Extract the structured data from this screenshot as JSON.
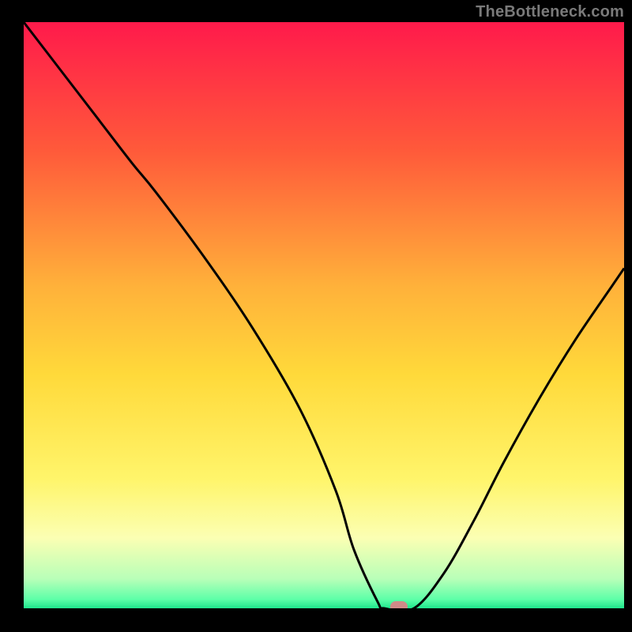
{
  "watermark": "TheBottleneck.com",
  "chart_data": {
    "type": "line",
    "title": "",
    "xlabel": "",
    "ylabel": "",
    "xlim": [
      0,
      100
    ],
    "ylim": [
      0,
      100
    ],
    "grid": false,
    "legend": "none",
    "background_gradient": [
      {
        "stop": 0.0,
        "color": "#ff1a4b"
      },
      {
        "stop": 0.22,
        "color": "#ff5a3a"
      },
      {
        "stop": 0.45,
        "color": "#ffb13a"
      },
      {
        "stop": 0.6,
        "color": "#ffd93a"
      },
      {
        "stop": 0.78,
        "color": "#fff56b"
      },
      {
        "stop": 0.88,
        "color": "#fbffb3"
      },
      {
        "stop": 0.95,
        "color": "#b8ffb8"
      },
      {
        "stop": 0.985,
        "color": "#5cffa8"
      },
      {
        "stop": 1.0,
        "color": "#1fe58c"
      }
    ],
    "series": [
      {
        "name": "bottleneck-curve",
        "x": [
          0,
          6,
          12,
          18,
          22,
          30,
          38,
          46,
          52,
          55,
          59,
          60,
          65,
          70,
          75,
          80,
          86,
          92,
          98,
          100
        ],
        "values": [
          100,
          92,
          84,
          76,
          71,
          60,
          48,
          34,
          20,
          10,
          1,
          0,
          0,
          6,
          15,
          25,
          36,
          46,
          55,
          58
        ]
      }
    ],
    "marker": {
      "x": 62.5,
      "y": 0,
      "color": "#cf8a88"
    }
  }
}
